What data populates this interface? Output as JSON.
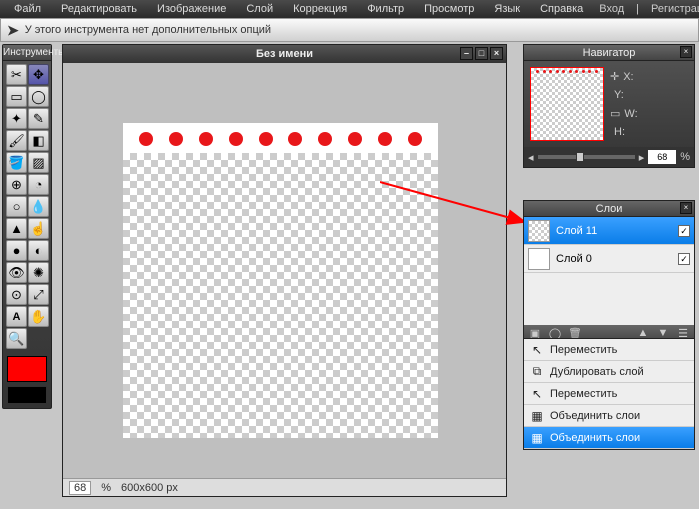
{
  "menu": [
    "Файл",
    "Редактировать",
    "Изображение",
    "Слой",
    "Коррекция",
    "Фильтр",
    "Просмотр",
    "Язык",
    "Справка"
  ],
  "auth": {
    "login": "Вход",
    "sep": "|",
    "register": "Регистрация"
  },
  "options": {
    "text": "У этого инструмента нет дополнительных опций"
  },
  "toolbox": {
    "title": "Инструменты"
  },
  "doc": {
    "title": "Без имени",
    "zoom": "68",
    "zoom_unit": "%",
    "dims": "600x600 px"
  },
  "nav": {
    "title": "Навигатор",
    "x": "X:",
    "y": "Y:",
    "w": "W:",
    "h": "H:",
    "zoom": "68",
    "zoom_unit": "%"
  },
  "layers": {
    "title": "Слои",
    "items": [
      {
        "name": "Слой 11",
        "selected": true
      },
      {
        "name": "Слой 0",
        "selected": false
      }
    ]
  },
  "ctx": {
    "items": [
      {
        "icon": "↖",
        "label": "Переместить",
        "sel": false
      },
      {
        "icon": "⧉",
        "label": "Дублировать слой",
        "sel": false
      },
      {
        "icon": "↖",
        "label": "Переместить",
        "sel": false
      },
      {
        "icon": "▦",
        "label": "Объединить слои",
        "sel": false
      },
      {
        "icon": "▦",
        "label": "Объединить слои",
        "sel": true
      }
    ]
  }
}
